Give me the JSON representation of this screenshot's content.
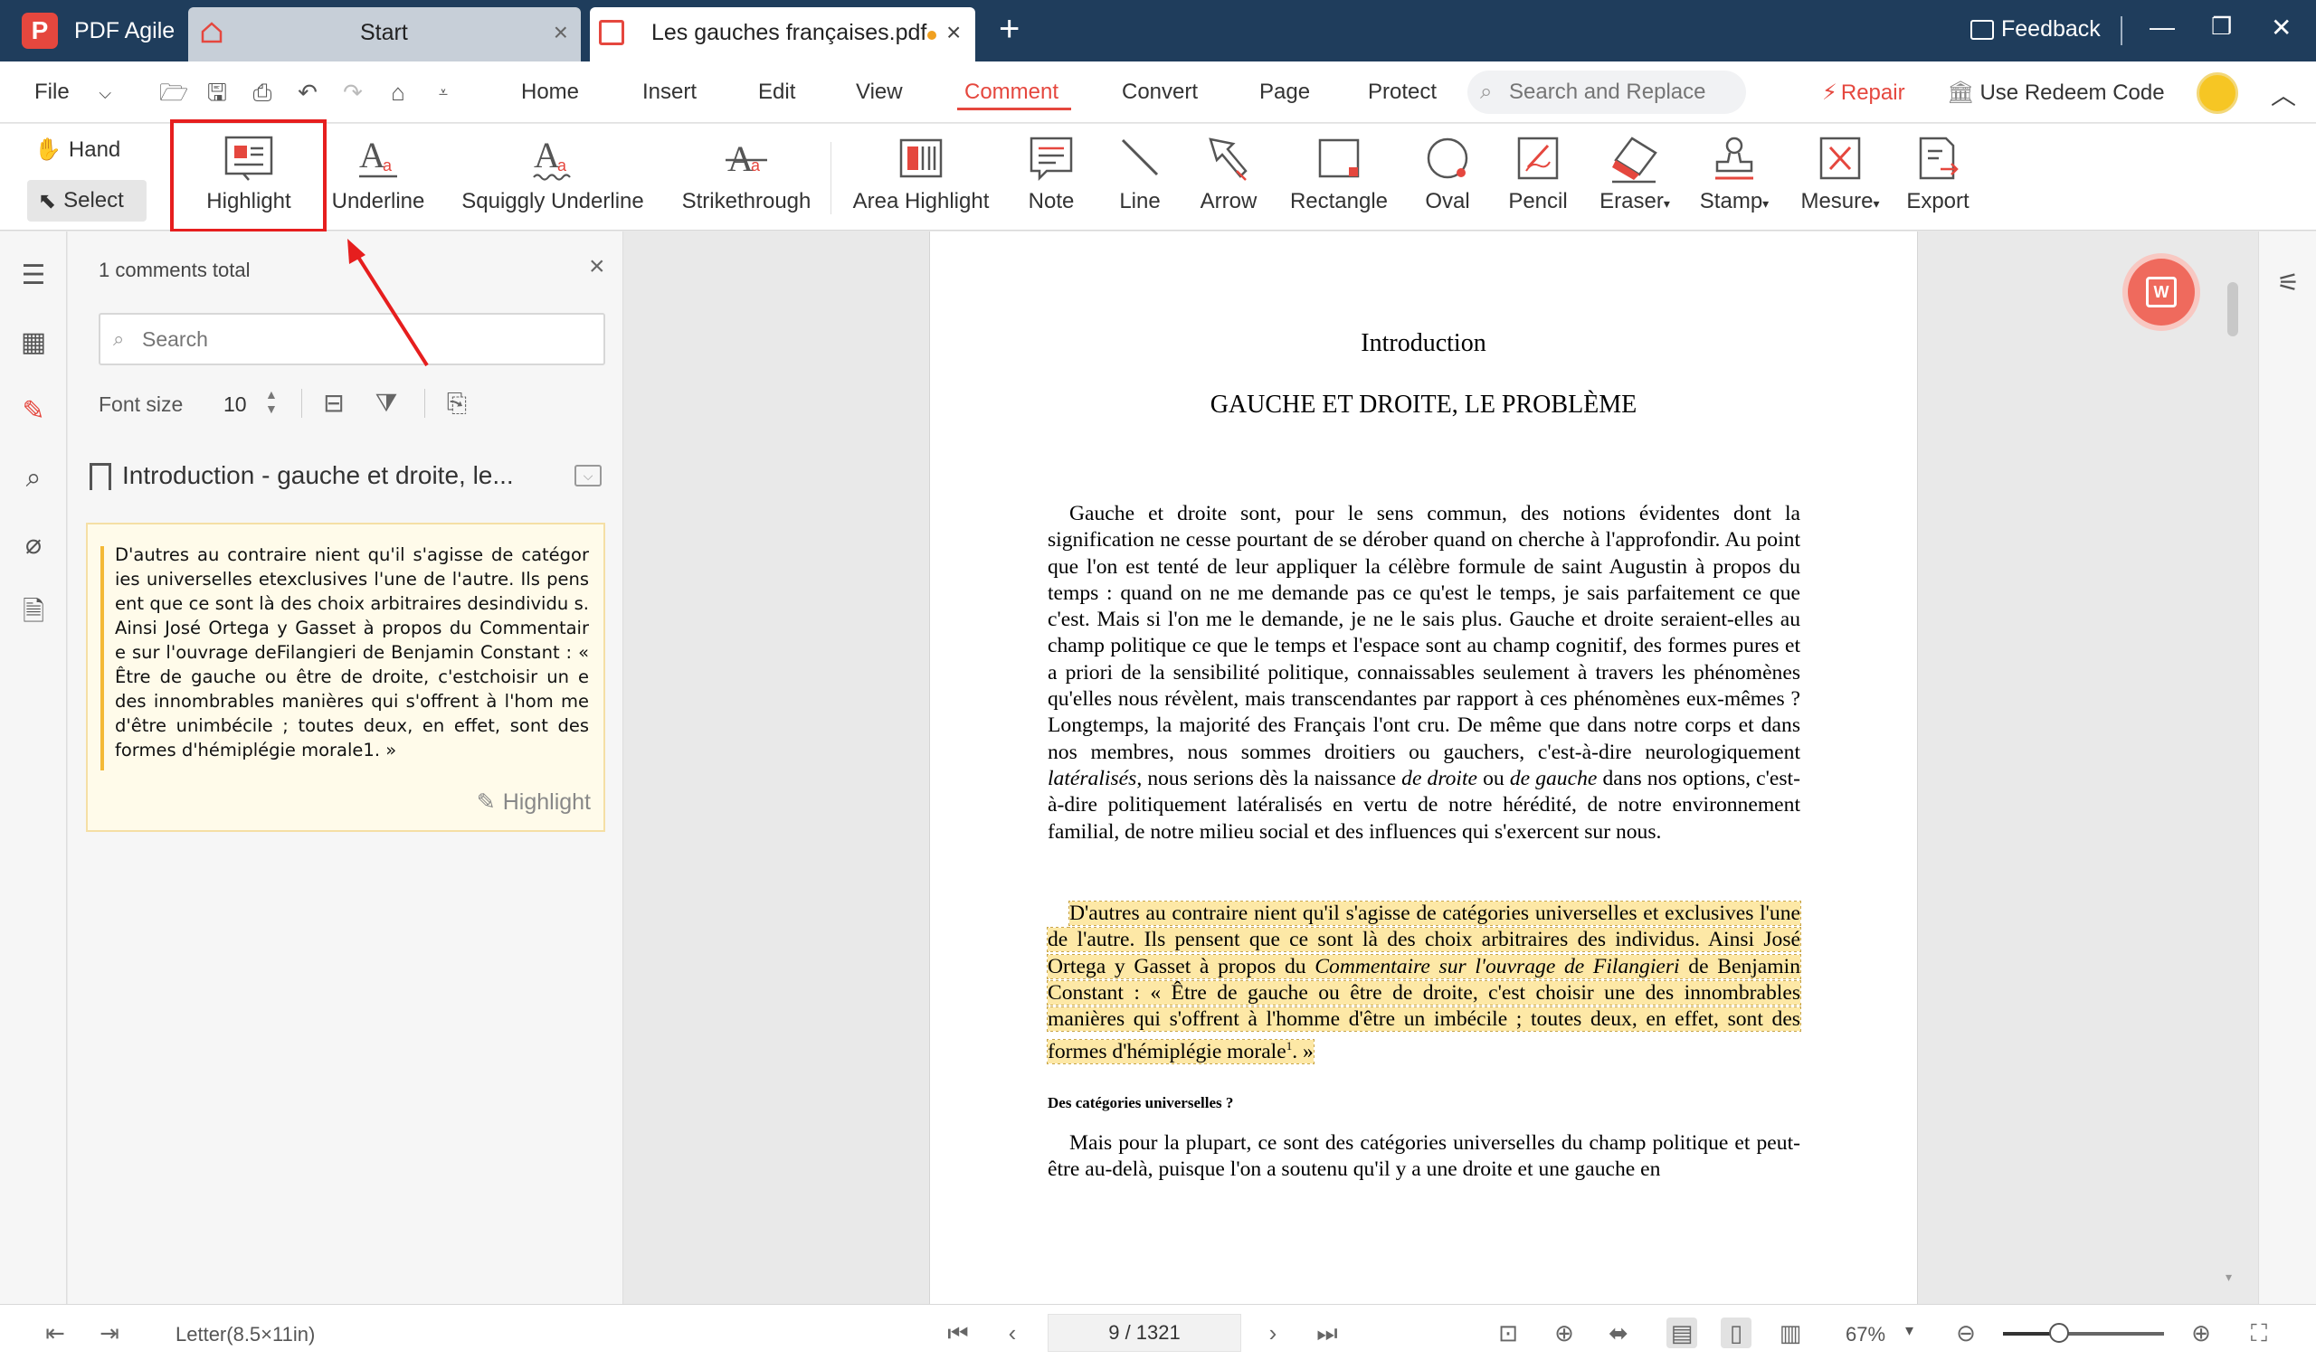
{
  "app": {
    "name": "PDF Agile"
  },
  "tabs": [
    {
      "label": "Start",
      "active": false
    },
    {
      "label": "Les gauches françaises.pdf",
      "active": true,
      "unsaved": true
    }
  ],
  "titlebar": {
    "feedback": "Feedback"
  },
  "menu": {
    "file": "File",
    "items": [
      "Home",
      "Insert",
      "Edit",
      "View",
      "Comment",
      "Convert",
      "Page",
      "Protect"
    ],
    "active": "Comment",
    "search_placeholder": "Search and Replace",
    "repair": "Repair",
    "redeem": "Use Redeem Code"
  },
  "ribbon": {
    "hand": "Hand",
    "select": "Select",
    "tools": [
      {
        "label": "Highlight",
        "icon": "highlight-icon"
      },
      {
        "label": "Underline",
        "icon": "underline-icon"
      },
      {
        "label": "Squiggly Underline",
        "icon": "squiggly-underline-icon"
      },
      {
        "label": "Strikethrough",
        "icon": "strikethrough-icon"
      },
      {
        "label": "Area Highlight",
        "icon": "area-highlight-icon"
      },
      {
        "label": "Note",
        "icon": "note-icon"
      },
      {
        "label": "Line",
        "icon": "line-icon"
      },
      {
        "label": "Arrow",
        "icon": "arrow-icon"
      },
      {
        "label": "Rectangle",
        "icon": "rectangle-icon"
      },
      {
        "label": "Oval",
        "icon": "oval-icon"
      },
      {
        "label": "Pencil",
        "icon": "pencil-icon"
      },
      {
        "label": "Eraser",
        "icon": "eraser-icon",
        "dropdown": true
      },
      {
        "label": "Stamp",
        "icon": "stamp-icon",
        "dropdown": true
      },
      {
        "label": "Mesure",
        "icon": "measure-icon",
        "dropdown": true
      },
      {
        "label": "Export",
        "icon": "export-icon"
      }
    ],
    "accent": "#e5473e"
  },
  "panel": {
    "total": "1 comments total",
    "search_placeholder": "Search",
    "font_size_label": "Font size",
    "font_size": "10",
    "bookmark_title": "Introduction - gauche et droite, le...",
    "comment": {
      "text": "D'autres au contraire nient qu'il s'agisse de catégor ies universelles etexclusives l'une de l'autre. Ils pens ent que ce sont là des choix arbitraires desindividu s. Ainsi José Ortega y Gasset à propos du Commentair e sur l'ouvrage deFilangieri de Benjamin Constant : « Être de gauche ou être de droite, c'estchoisir un e des innombrables manières qui s'offrent à l'hom me d'être unimbécile ; toutes deux, en effet, sont des formes d'hémiplégie morale1. »",
      "type": "Highlight"
    }
  },
  "document": {
    "intro": "Introduction",
    "heading": "GAUCHE ET DROITE, LE PROBLÈME",
    "para1": "Gauche et droite sont, pour le sens commun, des notions évidentes dont la signification ne cesse pourtant de se dérober quand on cherche à l'approfondir. Au point que l'on est tenté de leur appliquer la célèbre formule de saint Augustin à propos du temps : quand on ne me demande pas ce qu'est le temps, je sais parfaitement ce que c'est. Mais si l'on me le demande, je ne le sais plus. Gauche et droite seraient-elles au champ politique ce que le temps et l'espace sont au champ cognitif, des formes pures et a priori de la sensibilité politique, connaissables seulement à travers les phénomènes qu'elles nous révèlent, mais transcendantes par rapport à ces phénomènes eux-mêmes ? Longtemps, la majorité des Français l'ont cru. De même que dans notre corps et dans nos membres, nous sommes droitiers ou gauchers, c'est-à-dire neurologiquement",
    "para1_italic1": "latéralisés",
    "para1_mid": ", nous serions dès la naissance",
    "para1_italic2": "de droite",
    "para1_ou": "ou",
    "para1_italic3": "de gauche",
    "para1_end": "dans nos options, c'est-à-dire politiquement latéralisés en vertu de notre hérédité, de notre environnement familial, de notre milieu social et des influences qui s'exercent sur nous.",
    "para2_a": "D'autres au contraire nient qu'il s'agisse de catégories universelles et exclusives l'une de l'autre. Ils pensent que ce sont là des choix arbitraires des individus. Ainsi José Ortega y Gasset à propos du",
    "para2_italic": "Commentaire sur l'ouvrage de Filangieri",
    "para2_b": "de Benjamin Constant : « Être de gauche ou être de droite, c'est choisir une des innombrables manières qui s'offrent à l'homme d'être un imbécile ; toutes deux, en effet, sont des formes d'hémiplégie morale",
    "para2_sup": "1",
    "para2_c": ". »",
    "subhead": "Des catégories universelles ?",
    "para3": "Mais pour la plupart, ce sont des catégories universelles du champ politique et peut-être au-delà, puisque l'on a soutenu qu'il y a une droite et une gauche en",
    "highlight_color": "#fde8a6"
  },
  "statusbar": {
    "paper": "Letter(8.5×11in)",
    "page": "9 / 1321",
    "zoom": "67%",
    "zoom_fraction": 0.35
  }
}
